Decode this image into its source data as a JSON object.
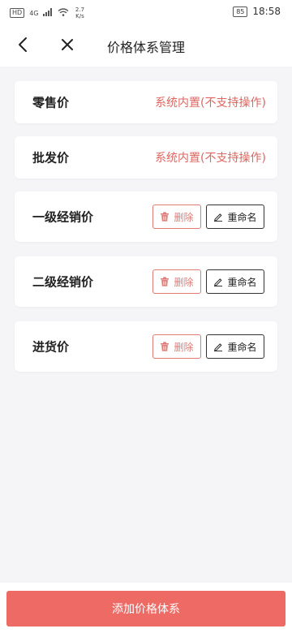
{
  "status_bar": {
    "network_badge": "HD",
    "network_type": "4G",
    "speed_value": "2.7",
    "speed_unit": "K/s",
    "battery": "85",
    "time": "18:58"
  },
  "header": {
    "title": "价格体系管理",
    "back_icon": "chevron-left-icon",
    "close_icon": "close-icon"
  },
  "price_items": [
    {
      "name": "零售价",
      "note": "系统内置(不支持操作)"
    },
    {
      "name": "批发价",
      "note": "系统内置(不支持操作)"
    },
    {
      "name": "一级经销价",
      "delete_label": "删除",
      "rename_label": "重命名"
    },
    {
      "name": "二级经销价",
      "delete_label": "删除",
      "rename_label": "重命名"
    },
    {
      "name": "进货价",
      "delete_label": "删除",
      "rename_label": "重命名"
    }
  ],
  "footer": {
    "add_button_label": "添加价格体系"
  },
  "colors": {
    "accent": "#ee6a65",
    "note_text": "#e0655f",
    "delete_border": "#e07a75",
    "background": "#f5f5f7"
  }
}
